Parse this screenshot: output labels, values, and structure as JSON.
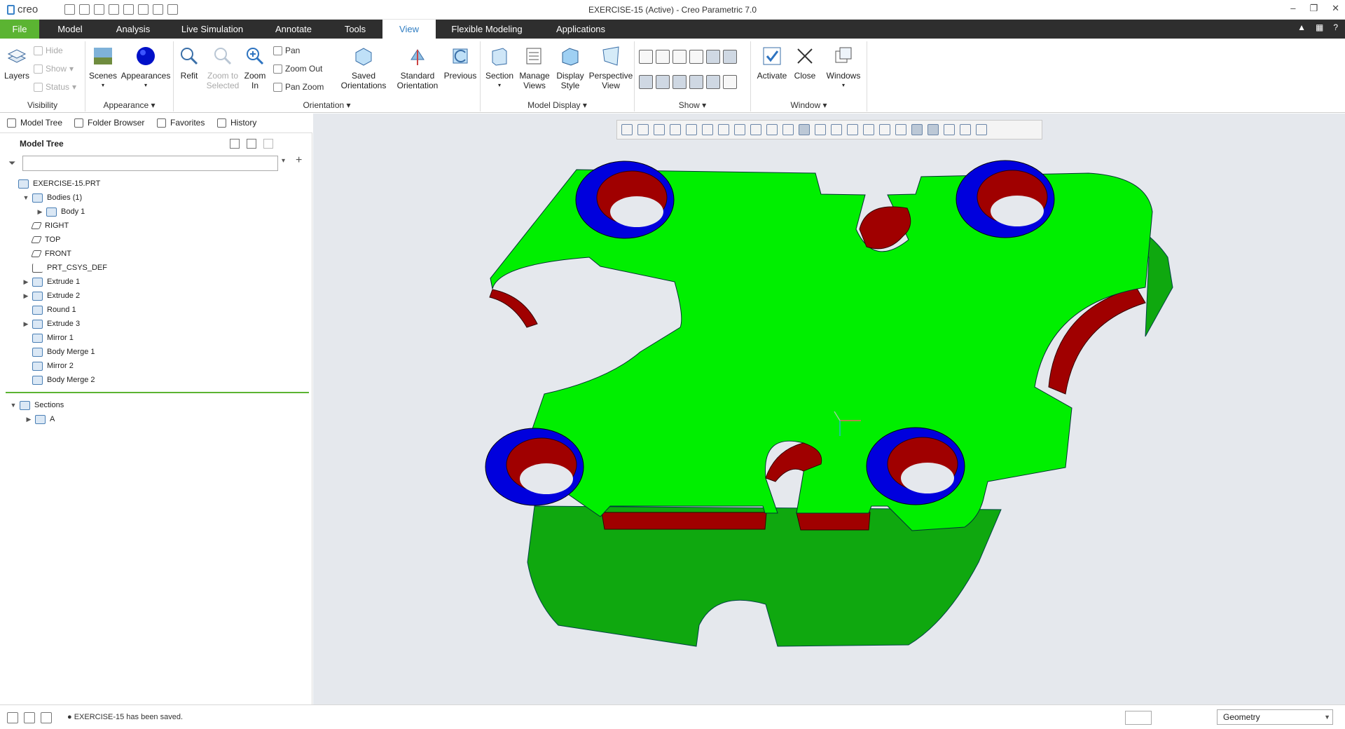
{
  "titlebar": {
    "logo": "creo",
    "title": "EXERCISE-15 (Active) - Creo Parametric 7.0",
    "controls": [
      "–",
      "❐",
      "✕"
    ]
  },
  "tabs": [
    "File",
    "Model",
    "Analysis",
    "Live Simulation",
    "Annotate",
    "Tools",
    "View",
    "Flexible Modeling",
    "Applications"
  ],
  "active_tab": "View",
  "ribbon": {
    "visibility": {
      "label": "Visibility",
      "layers": "Layers",
      "hide": "Hide",
      "show": "Show",
      "status": "Status"
    },
    "appearance": {
      "label": "Appearance",
      "scenes": "Scenes",
      "appearances": "Appearances"
    },
    "orientation": {
      "label": "Orientation",
      "refit": "Refit",
      "zoom_selected": "Zoom to Selected",
      "zoom_in": "Zoom In",
      "pan": "Pan",
      "zoom_out": "Zoom Out",
      "pan_zoom": "Pan Zoom",
      "saved": "Saved Orientations",
      "standard": "Standard Orientation",
      "previous": "Previous"
    },
    "model_display": {
      "label": "Model Display",
      "section": "Section",
      "manage_views": "Manage Views",
      "display_style": "Display Style",
      "perspective": "Perspective View"
    },
    "show": {
      "label": "Show"
    },
    "window": {
      "label": "Window",
      "activate": "Activate",
      "close": "Close",
      "windows": "Windows"
    }
  },
  "panel_tabs": [
    "Model Tree",
    "Folder Browser",
    "Favorites",
    "History"
  ],
  "model_tree": {
    "title": "Model Tree",
    "filter_placeholder": "",
    "items": [
      {
        "label": "EXERCISE-15.PRT",
        "level": 0,
        "toggle": "",
        "icon": "part"
      },
      {
        "label": "Bodies (1)",
        "level": 1,
        "toggle": "▼",
        "icon": "bodies"
      },
      {
        "label": "Body 1",
        "level": 2,
        "toggle": "▶",
        "icon": "body"
      },
      {
        "label": "RIGHT",
        "level": 1,
        "toggle": "",
        "icon": "plane"
      },
      {
        "label": "TOP",
        "level": 1,
        "toggle": "",
        "icon": "plane"
      },
      {
        "label": "FRONT",
        "level": 1,
        "toggle": "",
        "icon": "plane"
      },
      {
        "label": "PRT_CSYS_DEF",
        "level": 1,
        "toggle": "",
        "icon": "csys"
      },
      {
        "label": "Extrude 1",
        "level": 1,
        "toggle": "▶",
        "icon": "extrude"
      },
      {
        "label": "Extrude 2",
        "level": 1,
        "toggle": "▶",
        "icon": "extrude"
      },
      {
        "label": "Round 1",
        "level": 1,
        "toggle": "",
        "icon": "round"
      },
      {
        "label": "Extrude 3",
        "level": 1,
        "toggle": "▶",
        "icon": "extrude"
      },
      {
        "label": "Mirror 1",
        "level": 1,
        "toggle": "",
        "icon": "mirror"
      },
      {
        "label": "Body Merge 1",
        "level": 1,
        "toggle": "",
        "icon": "merge"
      },
      {
        "label": "Mirror 2",
        "level": 1,
        "toggle": "",
        "icon": "mirror"
      },
      {
        "label": "Body Merge 2",
        "level": 1,
        "toggle": "",
        "icon": "merge"
      }
    ],
    "sections_label": "Sections",
    "sections": [
      {
        "label": "A"
      }
    ]
  },
  "status": {
    "message": "EXERCISE-15 has been saved.",
    "filter_value": "Geometry"
  },
  "colors": {
    "face": "#00ef00",
    "side": "#0fa80f",
    "cut": "#a00000",
    "ring": "#0000dd",
    "file_tab": "#5bb432",
    "active_tab_text": "#2f7dc2"
  }
}
